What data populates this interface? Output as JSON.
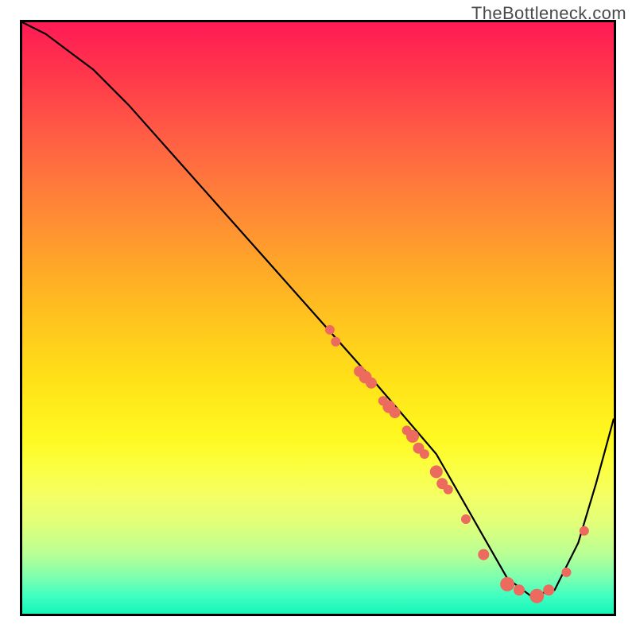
{
  "watermark": "TheBottleneck.com",
  "chart_data": {
    "type": "line",
    "title": "",
    "xlabel": "",
    "ylabel": "",
    "xlim": [
      0,
      100
    ],
    "ylim": [
      0,
      100
    ],
    "grid": false,
    "legend": false,
    "background": "gradient-red-to-green",
    "series": [
      {
        "name": "bottleneck-curve",
        "x": [
          0,
          4,
          8,
          12,
          18,
          26,
          34,
          42,
          50,
          58,
          64,
          70,
          74,
          78,
          82,
          86,
          90,
          94,
          97,
          100
        ],
        "y": [
          100,
          98,
          95,
          92,
          86,
          77,
          68,
          59,
          50,
          41,
          34,
          27,
          20,
          13,
          6,
          3,
          4,
          12,
          22,
          33
        ]
      }
    ],
    "markers": [
      {
        "x": 52,
        "y": 48,
        "r": 6
      },
      {
        "x": 53,
        "y": 46,
        "r": 6
      },
      {
        "x": 57,
        "y": 41,
        "r": 7
      },
      {
        "x": 58,
        "y": 40,
        "r": 8
      },
      {
        "x": 59,
        "y": 39,
        "r": 7
      },
      {
        "x": 61,
        "y": 36,
        "r": 6
      },
      {
        "x": 62,
        "y": 35,
        "r": 8
      },
      {
        "x": 63,
        "y": 34,
        "r": 7
      },
      {
        "x": 65,
        "y": 31,
        "r": 6
      },
      {
        "x": 66,
        "y": 30,
        "r": 8
      },
      {
        "x": 67,
        "y": 28,
        "r": 7
      },
      {
        "x": 68,
        "y": 27,
        "r": 6
      },
      {
        "x": 70,
        "y": 24,
        "r": 8
      },
      {
        "x": 71,
        "y": 22,
        "r": 7
      },
      {
        "x": 72,
        "y": 21,
        "r": 6
      },
      {
        "x": 75,
        "y": 16,
        "r": 6
      },
      {
        "x": 78,
        "y": 10,
        "r": 7
      },
      {
        "x": 82,
        "y": 5,
        "r": 9
      },
      {
        "x": 84,
        "y": 4,
        "r": 7
      },
      {
        "x": 87,
        "y": 3,
        "r": 9
      },
      {
        "x": 89,
        "y": 4,
        "r": 7
      },
      {
        "x": 92,
        "y": 7,
        "r": 6
      },
      {
        "x": 95,
        "y": 14,
        "r": 6
      }
    ]
  }
}
